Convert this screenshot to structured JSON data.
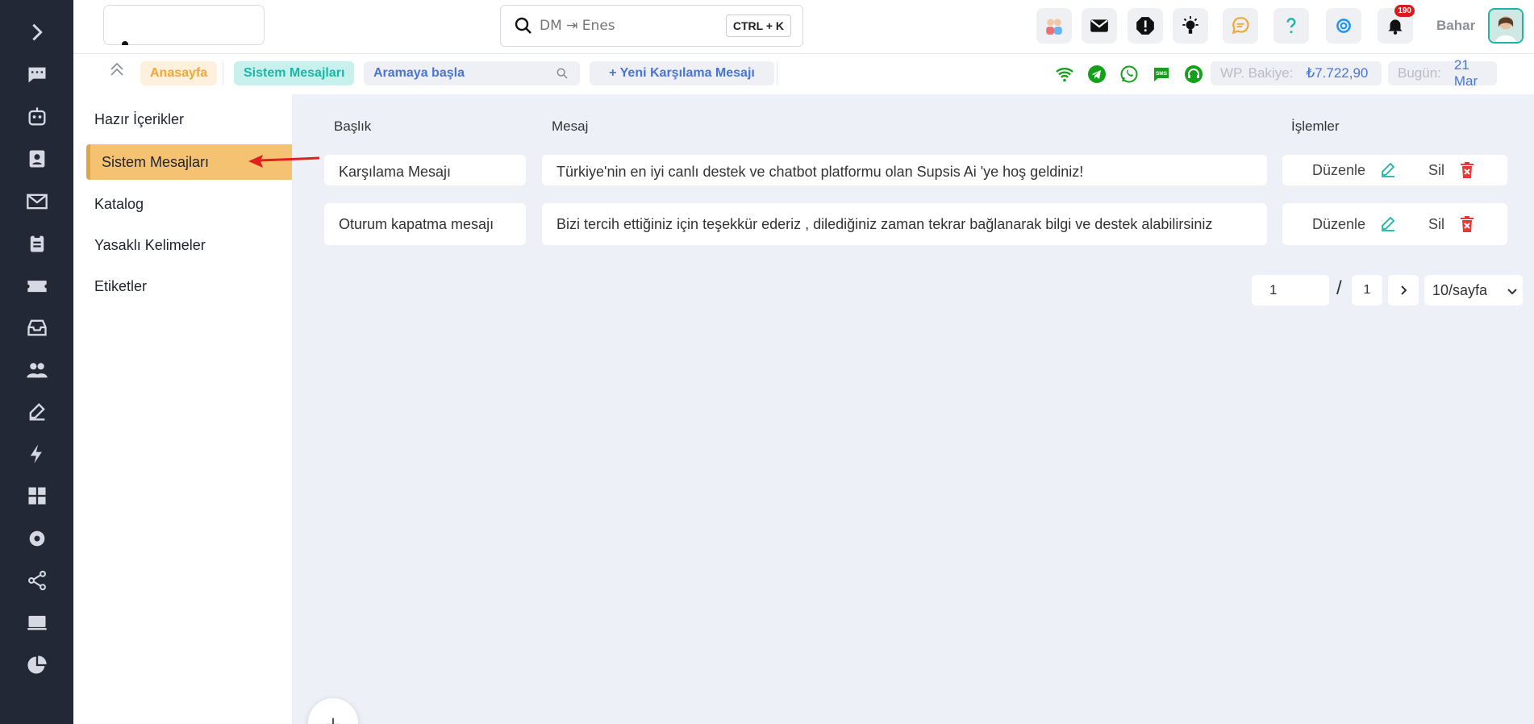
{
  "header": {
    "search_placeholder": "DM ⇥ Enes",
    "search_shortcut": "CTRL + K",
    "notification_count": "190",
    "username": "Bahar"
  },
  "subbar": {
    "home": "Anasayfa",
    "current": "Sistem Mesajları",
    "search_placeholder": "Aramaya başla",
    "new_message": "+ Yeni Karşılama Mesajı",
    "balance_label": "WP. Bakiye:",
    "balance_value": "₺7.722,90",
    "today_label": "Bugün:",
    "today_value": "21 Mar"
  },
  "sidebar": {
    "items": [
      {
        "label": "Hazır İçerikler"
      },
      {
        "label": "Sistem Mesajları"
      },
      {
        "label": "Katalog"
      },
      {
        "label": "Yasaklı Kelimeler"
      },
      {
        "label": "Etiketler"
      }
    ]
  },
  "table": {
    "columns": [
      "Başlık",
      "Mesaj",
      "İşlemler"
    ],
    "rows": [
      {
        "title": "Karşılama Mesajı",
        "message": "Türkiye'nin en iyi canlı destek ve chatbot platformu olan Supsis Ai 'ye hoş geldiniz!"
      },
      {
        "title": "Oturum kapatma mesajı",
        "message": "Bizi tercih ettiğiniz için teşekkür ederiz , dilediğiniz zaman tekrar bağlanarak bilgi ve destek alabilirsiniz"
      }
    ],
    "edit_label": "Düzenle",
    "delete_label": "Sil"
  },
  "pagination": {
    "current_page": "1",
    "separator": "/",
    "total_pages": "1",
    "page_size": "10/sayfa"
  },
  "fab": {
    "label": "+"
  },
  "colors": {
    "rail": "#232836",
    "accent_teal": "#1bb6a6",
    "accent_orange": "#f5c272",
    "link_blue": "#4a76d3",
    "danger": "#e53935"
  }
}
